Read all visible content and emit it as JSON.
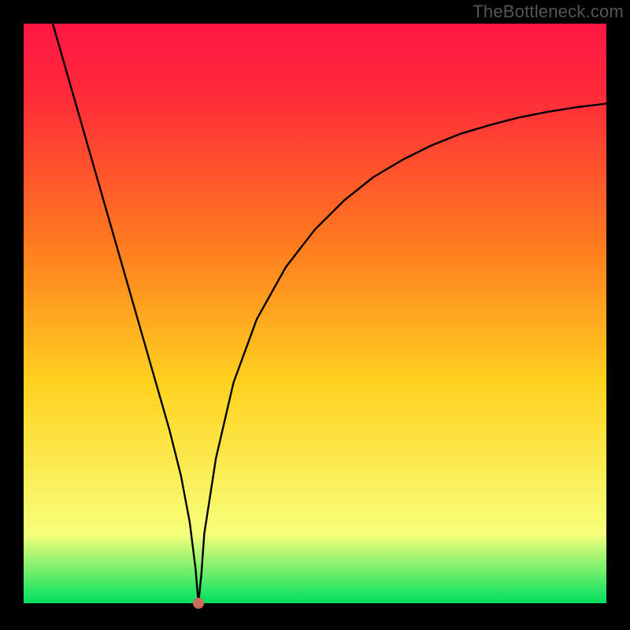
{
  "watermark": "TheBottleneck.com",
  "chart_data": {
    "type": "line",
    "title": "",
    "xlabel": "",
    "ylabel": "",
    "xlim": [
      0,
      100
    ],
    "ylim": [
      0,
      100
    ],
    "background_gradient": {
      "colors": [
        "#00e060",
        "#f7ff7a",
        "#ffd21f",
        "#ff7a1f",
        "#ff2a3a",
        "#ff1744"
      ],
      "positions": [
        0.0,
        0.12,
        0.38,
        0.62,
        0.88,
        1.0
      ],
      "direction": "bottom-to-top"
    },
    "series": [
      {
        "name": "bottleneck-curve",
        "x": [
          5,
          7,
          9,
          11,
          13,
          15,
          17,
          19,
          21,
          23,
          25,
          27,
          28.5,
          29.5,
          30,
          30.5,
          31,
          33,
          36,
          40,
          45,
          50,
          55,
          60,
          65,
          70,
          75,
          80,
          85,
          90,
          95,
          100
        ],
        "values": [
          100,
          93,
          86,
          79,
          72,
          65,
          58,
          51,
          44,
          37,
          30,
          22,
          14,
          6,
          0,
          5,
          12,
          25,
          38,
          49,
          58,
          64.5,
          69.5,
          73.5,
          76.5,
          79,
          81,
          82.5,
          83.8,
          84.8,
          85.6,
          86.2
        ]
      }
    ],
    "marker": {
      "x": 30,
      "y": 0,
      "color": "#cf6d5b",
      "radius": 7
    }
  }
}
